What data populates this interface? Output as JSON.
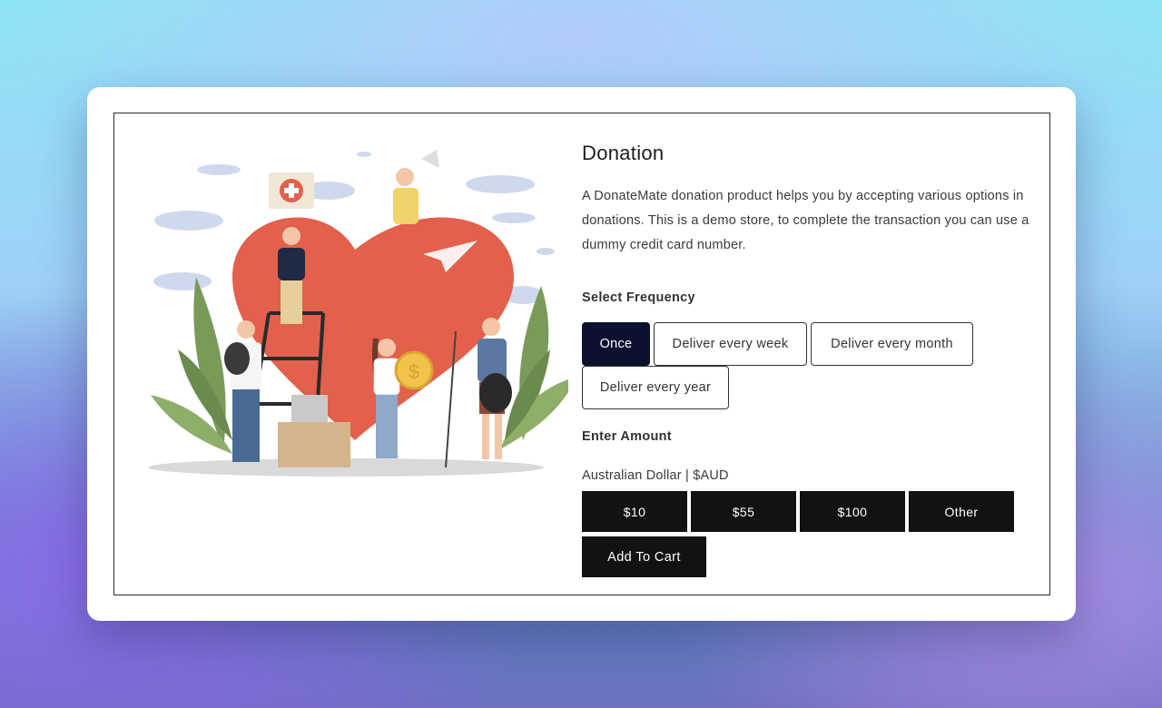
{
  "product": {
    "title": "Donation",
    "description": "A DonateMate donation product helps you by accepting various options in donations. This is a demo store, to complete the transaction you can use a dummy credit card number."
  },
  "frequency": {
    "label": "Select Frequency",
    "selected": "Once",
    "options": [
      "Once",
      "Deliver every week",
      "Deliver every month",
      "Deliver every year"
    ]
  },
  "amount": {
    "label": "Enter Amount",
    "currency": "Australian Dollar | $AUD",
    "options": [
      "$10",
      "$55",
      "$100",
      "Other"
    ]
  },
  "cart": {
    "button_label": "Add To Cart"
  },
  "colors": {
    "selected_option": "#0d1130",
    "button": "#121212",
    "heart": "#e2604c"
  },
  "illustration": {
    "icon": "donation-volunteers-heart-illustration"
  }
}
